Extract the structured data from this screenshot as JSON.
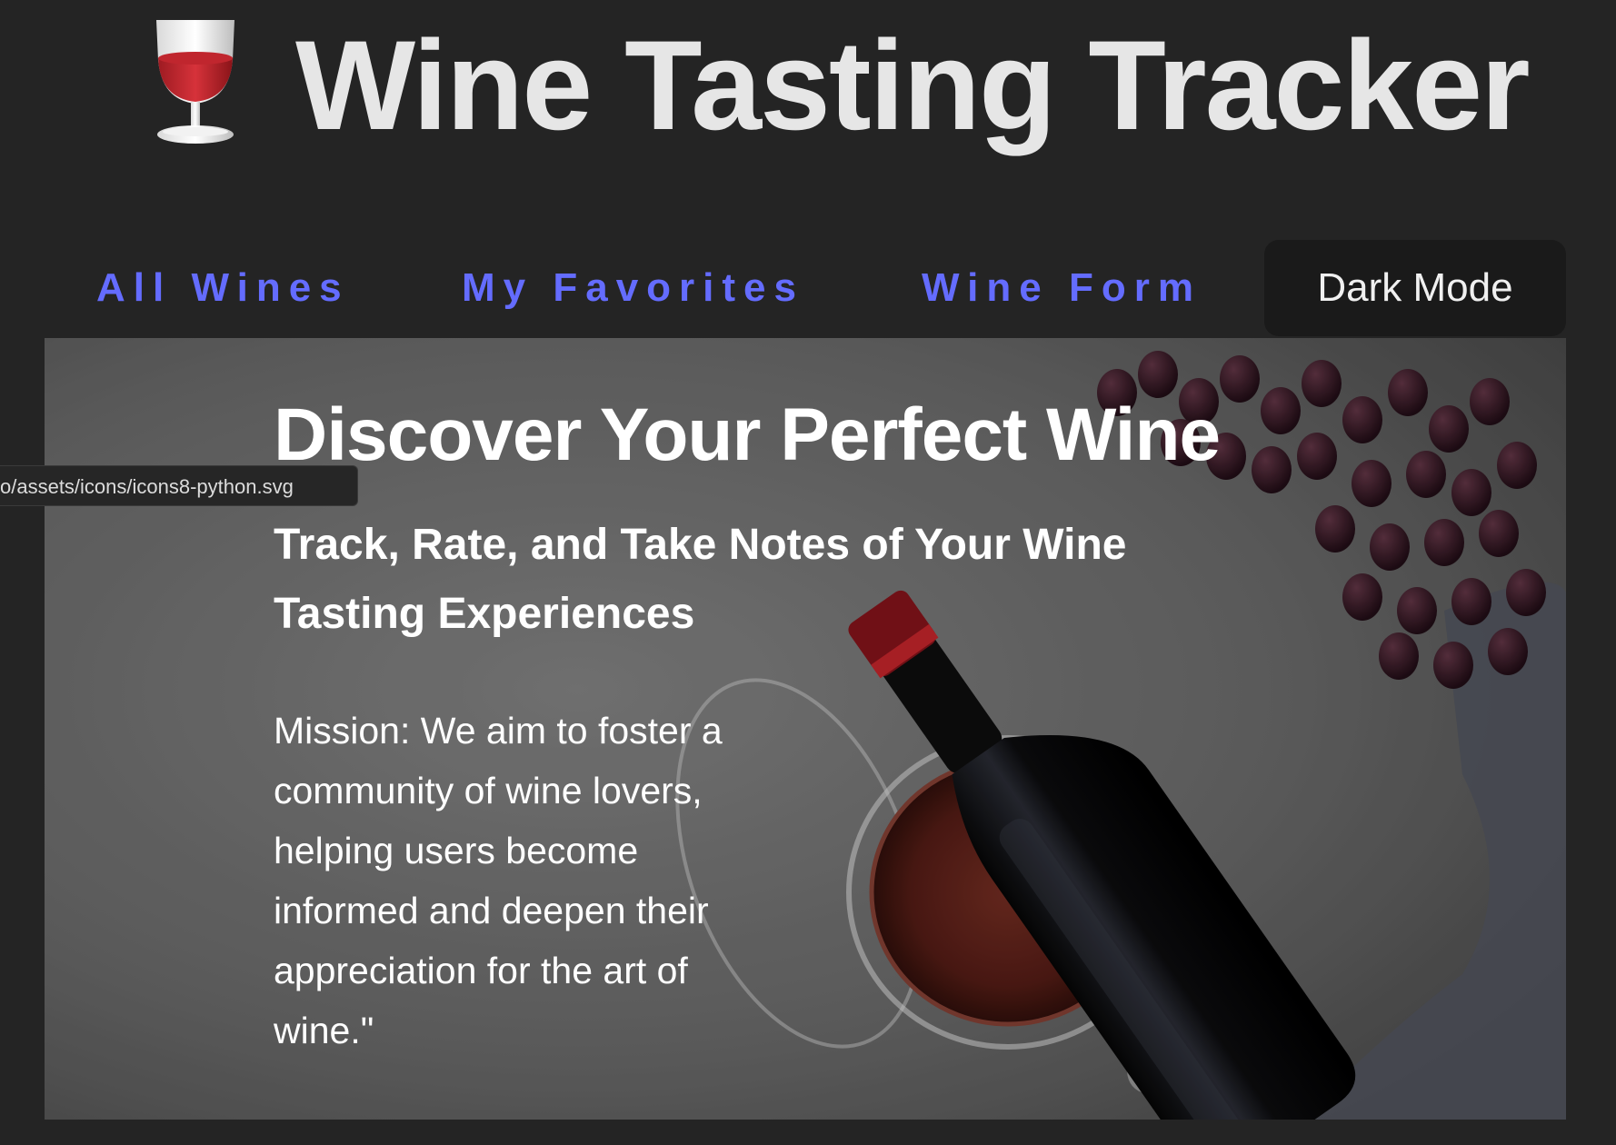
{
  "header": {
    "logo_icon": "wine-glass-icon",
    "title": "Wine Tasting Tracker"
  },
  "nav": {
    "links": [
      {
        "label": "All Wines"
      },
      {
        "label": "My Favorites"
      },
      {
        "label": "Wine Form"
      }
    ],
    "dark_mode_label": "Dark Mode"
  },
  "hero": {
    "title": "Discover Your Perfect Wine",
    "subtitle": "Track, Rate, and Take Notes of Your Wine Tasting Experiences",
    "mission": "Mission: We aim to foster a community of wine lovers, helping users become informed and deepen their appreciation for the art of wine.\""
  },
  "status_bar": {
    "url": "o/assets/icons/icons8-python.svg"
  },
  "colors": {
    "background": "#242424",
    "nav_link": "#646cff",
    "button_bg": "#1a1a1a",
    "title_text": "#e6e6e6"
  }
}
